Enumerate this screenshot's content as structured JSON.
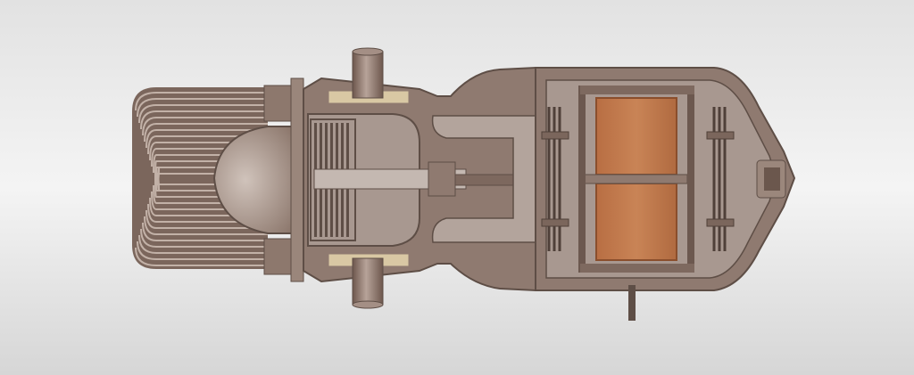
{
  "figure": {
    "subject": "",
    "text_labels": []
  },
  "colors": {
    "background_light": "#f6f6f6",
    "background_dark": "#cfcfcf",
    "housing": "#8f7a70",
    "housing_dark": "#5e4e46",
    "housing_light": "#b9a79e",
    "interior": "#a89890",
    "interior_light": "#c7bbb4",
    "coil": "#c0784c",
    "coil_dark": "#9c5a35",
    "gasket": "#d9c8a4",
    "tube": "#8a7369"
  },
  "icons": [
    "heat-exchanger-fins",
    "regenerator-disc",
    "piston-rod",
    "motor-coil",
    "spring-flexure",
    "inlet-port",
    "outlet-port",
    "end-nozzle",
    "wire-lead"
  ]
}
